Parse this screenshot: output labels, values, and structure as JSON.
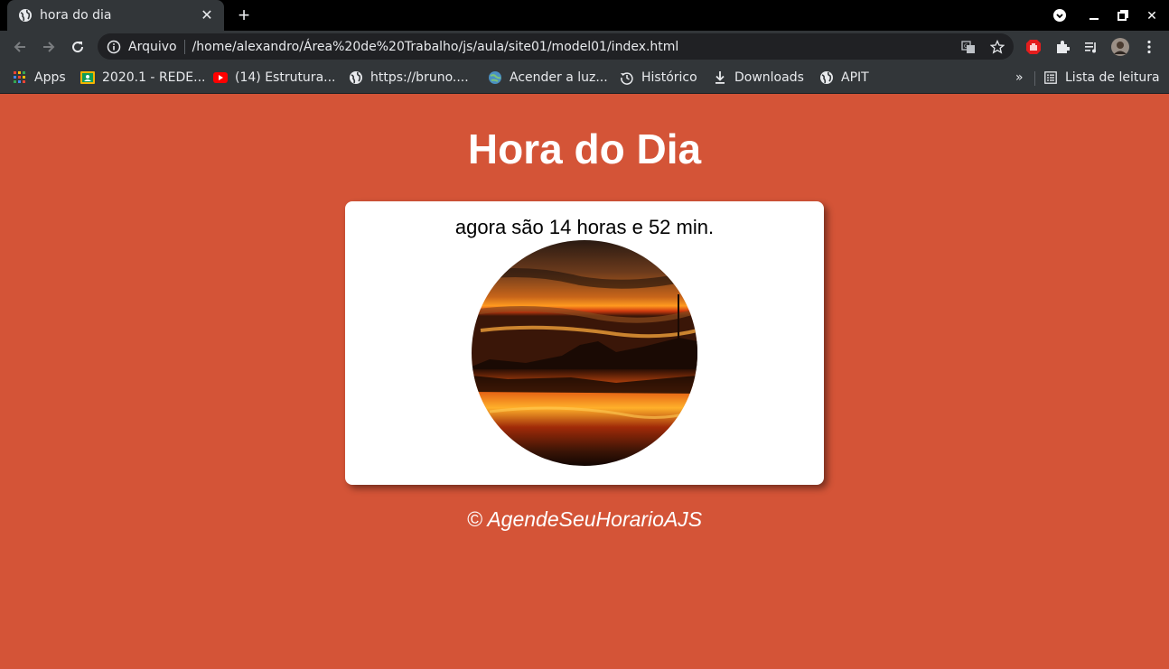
{
  "browser": {
    "tab": {
      "title": "hora do dia"
    },
    "address": {
      "security_label": "Arquivo",
      "url": "/home/alexandro/Área%20de%20Trabalho/js/aula/site01/model01/index.html"
    },
    "bookmarks": [
      {
        "label": "Apps",
        "icon": "apps-grid-icon"
      },
      {
        "label": "2020.1 - REDE...",
        "icon": "classroom-icon"
      },
      {
        "label": "(14) Estrutura...",
        "icon": "youtube-icon"
      },
      {
        "label": "https://bruno....",
        "icon": "globe-icon"
      },
      {
        "label": "Acender a luz...",
        "icon": "globe-colored-icon"
      },
      {
        "label": "Histórico",
        "icon": "history-icon"
      },
      {
        "label": "Downloads",
        "icon": "download-icon"
      },
      {
        "label": "APIT",
        "icon": "globe-icon"
      }
    ],
    "overflow_label": "»",
    "reading_list_label": "Lista de leitura"
  },
  "page": {
    "title": "Hora do Dia",
    "message": "agora são 14 horas e 52 min.",
    "image": "sunset-photo",
    "footer": "© AgendeSeuHorarioAJS"
  },
  "colors": {
    "background": "#d45437",
    "card": "#ffffff"
  }
}
